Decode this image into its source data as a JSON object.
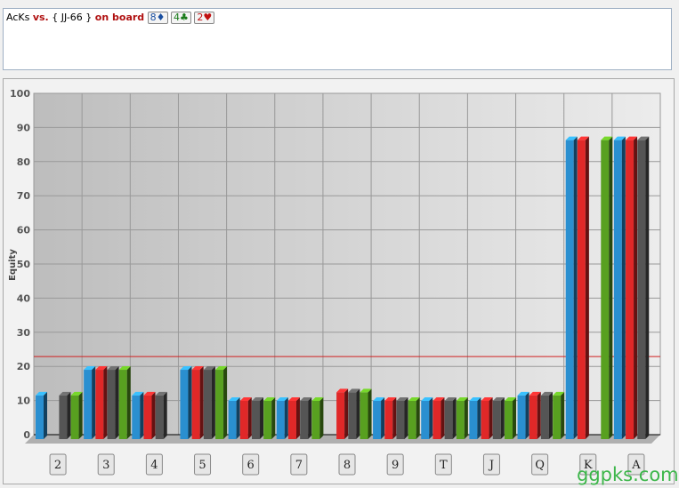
{
  "header": {
    "hand": "AcKs",
    "vs": "vs.",
    "range": "{ JJ-66 }",
    "on_board": "on board",
    "board": [
      {
        "rank": "8",
        "suit": "♦",
        "color": "#1a4fa0"
      },
      {
        "rank": "4",
        "suit": "♣",
        "color": "#1a7a1a"
      },
      {
        "rank": "2",
        "suit": "♥",
        "color": "#c01010"
      }
    ]
  },
  "watermark": "ggpks.com",
  "chart_data": {
    "type": "bar",
    "ylabel": "Equity",
    "ylim": [
      0,
      100
    ],
    "yticks": [
      0,
      10,
      20,
      30,
      40,
      50,
      60,
      70,
      80,
      90,
      100
    ],
    "grid": true,
    "categories": [
      "2",
      "3",
      "4",
      "5",
      "6",
      "7",
      "8",
      "9",
      "T",
      "J",
      "Q",
      "K",
      "A"
    ],
    "series": [
      {
        "color": "#2a8fd0",
        "values": [
          11.5,
          19,
          11.5,
          19,
          9.9,
          9.9,
          null,
          9.9,
          9.9,
          9.9,
          11.5,
          86.3,
          86.3
        ]
      },
      {
        "color": "#e02828",
        "values": [
          null,
          19,
          11.5,
          19,
          9.9,
          9.9,
          12.4,
          9.9,
          9.9,
          9.9,
          11.5,
          86.3,
          86.3
        ]
      },
      {
        "color": "#555555",
        "values": [
          11.5,
          19,
          11.5,
          19,
          9.9,
          9.9,
          12.4,
          9.9,
          9.9,
          9.9,
          11.5,
          null,
          86.3
        ]
      },
      {
        "color": "#58a020",
        "values": [
          11.5,
          19,
          null,
          19,
          9.9,
          9.9,
          12.4,
          9.9,
          9.9,
          9.9,
          11.5,
          86.3,
          null
        ]
      }
    ],
    "reference_line": {
      "value": 22.9,
      "color": "#d02020"
    }
  }
}
